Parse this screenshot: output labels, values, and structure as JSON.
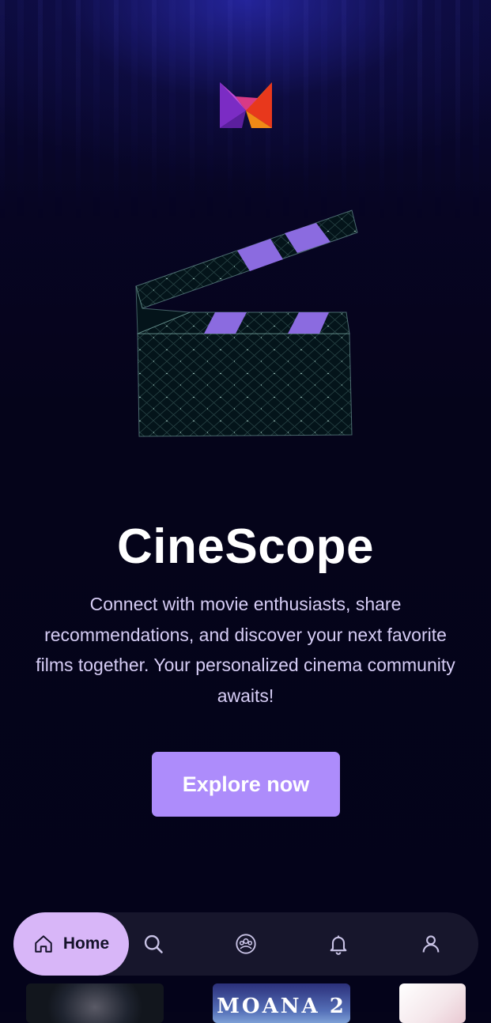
{
  "app": {
    "name": "CineScope",
    "tagline": "Connect with movie enthusiasts, share recommendations, and discover your next favorite films together. Your personalized cinema community awaits!"
  },
  "hero": {
    "logo_icon": "brand-logo-icon",
    "illustration_icon": "clapperboard-icon"
  },
  "cta": {
    "label": "Explore now",
    "color": "#ad8cfb"
  },
  "nav": {
    "active_color": "#d8b6f8",
    "items": [
      {
        "label": "Home",
        "icon": "home-icon",
        "active": true
      },
      {
        "label": "",
        "icon": "search-icon",
        "active": false
      },
      {
        "label": "",
        "icon": "community-icon",
        "active": false
      },
      {
        "label": "",
        "icon": "bell-icon",
        "active": false
      },
      {
        "label": "",
        "icon": "profile-icon",
        "active": false
      }
    ]
  },
  "thumbnails": [
    {
      "title": "",
      "icon": "movie-poster"
    },
    {
      "title": "MOANA 2",
      "icon": "movie-poster"
    },
    {
      "title": "",
      "icon": "movie-poster"
    }
  ],
  "colors": {
    "background": "#05041a",
    "text_primary": "#ffffff",
    "text_secondary": "#d6cdf5"
  }
}
